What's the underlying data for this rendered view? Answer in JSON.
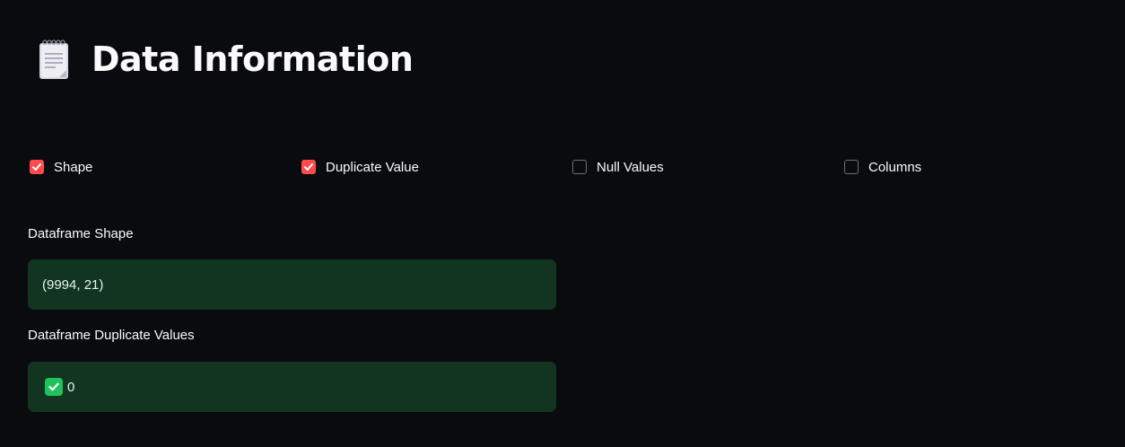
{
  "header": {
    "title": "Data Information",
    "icon": "notepad-icon"
  },
  "checkboxes": [
    {
      "label": "Shape",
      "checked": true
    },
    {
      "label": "Duplicate Value",
      "checked": true
    },
    {
      "label": "Null Values",
      "checked": false
    },
    {
      "label": "Columns",
      "checked": false
    }
  ],
  "shape_section": {
    "label": "Dataframe Shape",
    "value": "(9994, 21)"
  },
  "duplicate_section": {
    "label": "Dataframe Duplicate Values",
    "icon": "check-mark-icon",
    "value": "0"
  },
  "colors": {
    "background": "#0a0b0f",
    "checkbox_checked": "#ff4b4b",
    "success_bg": "#123522",
    "check_emoji": "#21c25e"
  }
}
